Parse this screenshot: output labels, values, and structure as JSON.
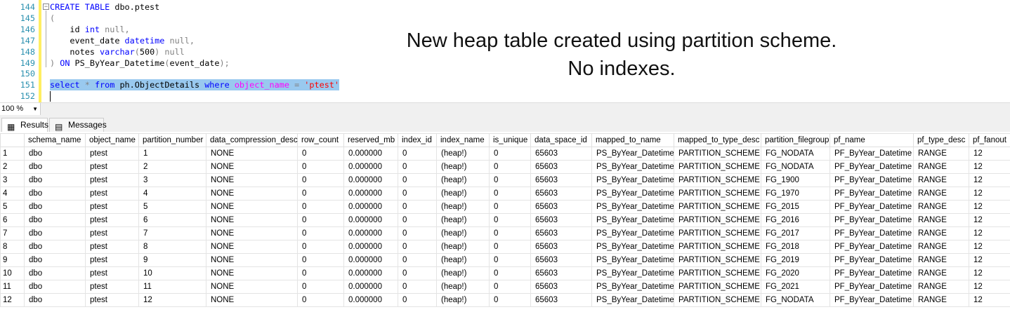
{
  "editor": {
    "line_numbers": [
      "144",
      "145",
      "146",
      "147",
      "148",
      "149",
      "150",
      "151",
      "152"
    ],
    "lines": [
      [
        [
          "kw",
          "CREATE TABLE "
        ],
        [
          "",
          "dbo.ptest"
        ]
      ],
      [
        [
          "gr",
          "("
        ]
      ],
      [
        [
          "",
          "    id "
        ],
        [
          "kw",
          "int "
        ],
        [
          "gr",
          "null,"
        ]
      ],
      [
        [
          "",
          "    event_date "
        ],
        [
          "kw",
          "datetime "
        ],
        [
          "gr",
          "null,"
        ]
      ],
      [
        [
          "",
          "    notes "
        ],
        [
          "kw",
          "varchar"
        ],
        [
          "gr",
          "("
        ],
        [
          "",
          "500"
        ],
        [
          "gr",
          ") null"
        ]
      ],
      [
        [
          "gr",
          ") "
        ],
        [
          "kw",
          "ON "
        ],
        [
          "",
          "PS_ByYear_Datetime"
        ],
        [
          "gr",
          "("
        ],
        [
          "",
          "event_date"
        ],
        [
          "gr",
          ");"
        ]
      ],
      [],
      [
        [
          "kw",
          "select "
        ],
        [
          "gr",
          "* "
        ],
        [
          "kw",
          "from "
        ],
        [
          "",
          "ph.ObjectDetails "
        ],
        [
          "kw",
          "where "
        ],
        [
          "pk",
          "object_name "
        ],
        [
          "gr",
          "= "
        ],
        [
          "st",
          "'ptest'"
        ]
      ],
      []
    ]
  },
  "annotation": {
    "line1": "New heap table created using partition scheme.",
    "line2": "No indexes."
  },
  "zoom": {
    "value": "100 %"
  },
  "tabs": {
    "results": "Results",
    "messages": "Messages"
  },
  "grid": {
    "columns": [
      "",
      "schema_name",
      "object_name",
      "partition_number",
      "data_compression_desc",
      "row_count",
      "reserved_mb",
      "index_id",
      "index_name",
      "is_unique",
      "data_space_id",
      "mapped_to_name",
      "mapped_to_type_desc",
      "partition_filegroup",
      "pf_name",
      "pf_type_desc",
      "pf_fanout"
    ],
    "rows": [
      [
        "1",
        "dbo",
        "ptest",
        "1",
        "NONE",
        "0",
        "0.000000",
        "0",
        "(heap!)",
        "0",
        "65603",
        "PS_ByYear_Datetime",
        "PARTITION_SCHEME",
        "FG_NODATA",
        "PF_ByYear_Datetime",
        "RANGE",
        "12"
      ],
      [
        "2",
        "dbo",
        "ptest",
        "2",
        "NONE",
        "0",
        "0.000000",
        "0",
        "(heap!)",
        "0",
        "65603",
        "PS_ByYear_Datetime",
        "PARTITION_SCHEME",
        "FG_NODATA",
        "PF_ByYear_Datetime",
        "RANGE",
        "12"
      ],
      [
        "3",
        "dbo",
        "ptest",
        "3",
        "NONE",
        "0",
        "0.000000",
        "0",
        "(heap!)",
        "0",
        "65603",
        "PS_ByYear_Datetime",
        "PARTITION_SCHEME",
        "FG_1900",
        "PF_ByYear_Datetime",
        "RANGE",
        "12"
      ],
      [
        "4",
        "dbo",
        "ptest",
        "4",
        "NONE",
        "0",
        "0.000000",
        "0",
        "(heap!)",
        "0",
        "65603",
        "PS_ByYear_Datetime",
        "PARTITION_SCHEME",
        "FG_1970",
        "PF_ByYear_Datetime",
        "RANGE",
        "12"
      ],
      [
        "5",
        "dbo",
        "ptest",
        "5",
        "NONE",
        "0",
        "0.000000",
        "0",
        "(heap!)",
        "0",
        "65603",
        "PS_ByYear_Datetime",
        "PARTITION_SCHEME",
        "FG_2015",
        "PF_ByYear_Datetime",
        "RANGE",
        "12"
      ],
      [
        "6",
        "dbo",
        "ptest",
        "6",
        "NONE",
        "0",
        "0.000000",
        "0",
        "(heap!)",
        "0",
        "65603",
        "PS_ByYear_Datetime",
        "PARTITION_SCHEME",
        "FG_2016",
        "PF_ByYear_Datetime",
        "RANGE",
        "12"
      ],
      [
        "7",
        "dbo",
        "ptest",
        "7",
        "NONE",
        "0",
        "0.000000",
        "0",
        "(heap!)",
        "0",
        "65603",
        "PS_ByYear_Datetime",
        "PARTITION_SCHEME",
        "FG_2017",
        "PF_ByYear_Datetime",
        "RANGE",
        "12"
      ],
      [
        "8",
        "dbo",
        "ptest",
        "8",
        "NONE",
        "0",
        "0.000000",
        "0",
        "(heap!)",
        "0",
        "65603",
        "PS_ByYear_Datetime",
        "PARTITION_SCHEME",
        "FG_2018",
        "PF_ByYear_Datetime",
        "RANGE",
        "12"
      ],
      [
        "9",
        "dbo",
        "ptest",
        "9",
        "NONE",
        "0",
        "0.000000",
        "0",
        "(heap!)",
        "0",
        "65603",
        "PS_ByYear_Datetime",
        "PARTITION_SCHEME",
        "FG_2019",
        "PF_ByYear_Datetime",
        "RANGE",
        "12"
      ],
      [
        "10",
        "dbo",
        "ptest",
        "10",
        "NONE",
        "0",
        "0.000000",
        "0",
        "(heap!)",
        "0",
        "65603",
        "PS_ByYear_Datetime",
        "PARTITION_SCHEME",
        "FG_2020",
        "PF_ByYear_Datetime",
        "RANGE",
        "12"
      ],
      [
        "11",
        "dbo",
        "ptest",
        "11",
        "NONE",
        "0",
        "0.000000",
        "0",
        "(heap!)",
        "0",
        "65603",
        "PS_ByYear_Datetime",
        "PARTITION_SCHEME",
        "FG_2021",
        "PF_ByYear_Datetime",
        "RANGE",
        "12"
      ],
      [
        "12",
        "dbo",
        "ptest",
        "12",
        "NONE",
        "0",
        "0.000000",
        "0",
        "(heap!)",
        "0",
        "65603",
        "PS_ByYear_Datetime",
        "PARTITION_SCHEME",
        "FG_NODATA",
        "PF_ByYear_Datetime",
        "RANGE",
        "12"
      ]
    ]
  }
}
